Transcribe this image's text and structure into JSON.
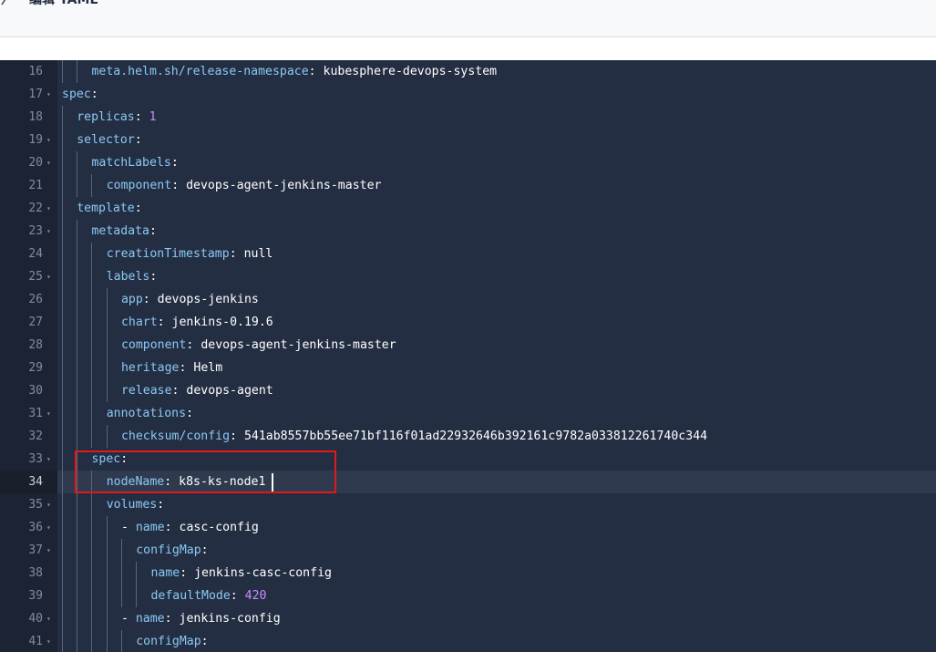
{
  "header": {
    "title": "编辑 YAML"
  },
  "editor": {
    "active_line": 34,
    "lines": [
      {
        "num": "16",
        "fold": false,
        "indent": 2,
        "key": "meta.helm.sh/release-namespace",
        "sep": ": ",
        "value": "kubesphere-devops-system",
        "vtype": "str"
      },
      {
        "num": "17",
        "fold": true,
        "indent": 0,
        "key": "spec",
        "sep": ":",
        "value": "",
        "vtype": "str"
      },
      {
        "num": "18",
        "fold": false,
        "indent": 1,
        "key": "replicas",
        "sep": ": ",
        "value": "1",
        "vtype": "num"
      },
      {
        "num": "19",
        "fold": true,
        "indent": 1,
        "key": "selector",
        "sep": ":",
        "value": "",
        "vtype": "str"
      },
      {
        "num": "20",
        "fold": true,
        "indent": 2,
        "key": "matchLabels",
        "sep": ":",
        "value": "",
        "vtype": "str"
      },
      {
        "num": "21",
        "fold": false,
        "indent": 3,
        "key": "component",
        "sep": ": ",
        "value": "devops-agent-jenkins-master",
        "vtype": "str"
      },
      {
        "num": "22",
        "fold": true,
        "indent": 1,
        "key": "template",
        "sep": ":",
        "value": "",
        "vtype": "str"
      },
      {
        "num": "23",
        "fold": true,
        "indent": 2,
        "key": "metadata",
        "sep": ":",
        "value": "",
        "vtype": "str"
      },
      {
        "num": "24",
        "fold": false,
        "indent": 3,
        "key": "creationTimestamp",
        "sep": ": ",
        "value": "null",
        "vtype": "str"
      },
      {
        "num": "25",
        "fold": true,
        "indent": 3,
        "key": "labels",
        "sep": ":",
        "value": "",
        "vtype": "str"
      },
      {
        "num": "26",
        "fold": false,
        "indent": 4,
        "key": "app",
        "sep": ": ",
        "value": "devops-jenkins",
        "vtype": "str"
      },
      {
        "num": "27",
        "fold": false,
        "indent": 4,
        "key": "chart",
        "sep": ": ",
        "value": "jenkins-0.19.6",
        "vtype": "str"
      },
      {
        "num": "28",
        "fold": false,
        "indent": 4,
        "key": "component",
        "sep": ": ",
        "value": "devops-agent-jenkins-master",
        "vtype": "str"
      },
      {
        "num": "29",
        "fold": false,
        "indent": 4,
        "key": "heritage",
        "sep": ": ",
        "value": "Helm",
        "vtype": "str"
      },
      {
        "num": "30",
        "fold": false,
        "indent": 4,
        "key": "release",
        "sep": ": ",
        "value": "devops-agent",
        "vtype": "str"
      },
      {
        "num": "31",
        "fold": true,
        "indent": 3,
        "key": "annotations",
        "sep": ":",
        "value": "",
        "vtype": "str"
      },
      {
        "num": "32",
        "fold": false,
        "indent": 4,
        "key": "checksum/config",
        "sep": ": ",
        "value": "541ab8557bb55ee71bf116f01ad22932646b392161c9782a033812261740c344",
        "vtype": "str"
      },
      {
        "num": "33",
        "fold": true,
        "indent": 2,
        "key": "spec",
        "sep": ":",
        "value": "",
        "vtype": "str"
      },
      {
        "num": "34",
        "fold": false,
        "indent": 3,
        "key": "nodeName",
        "sep": ": ",
        "value": "k8s-ks-node1",
        "vtype": "str"
      },
      {
        "num": "35",
        "fold": true,
        "indent": 3,
        "key": "volumes",
        "sep": ":",
        "value": "",
        "vtype": "str"
      },
      {
        "num": "36",
        "fold": true,
        "indent": 4,
        "dash": true,
        "key": "name",
        "sep": ": ",
        "value": "casc-config",
        "vtype": "str"
      },
      {
        "num": "37",
        "fold": true,
        "indent": 5,
        "key": "configMap",
        "sep": ":",
        "value": "",
        "vtype": "str"
      },
      {
        "num": "38",
        "fold": false,
        "indent": 6,
        "key": "name",
        "sep": ": ",
        "value": "jenkins-casc-config",
        "vtype": "str"
      },
      {
        "num": "39",
        "fold": false,
        "indent": 6,
        "key": "defaultMode",
        "sep": ": ",
        "value": "420",
        "vtype": "num"
      },
      {
        "num": "40",
        "fold": true,
        "indent": 4,
        "dash": true,
        "key": "name",
        "sep": ": ",
        "value": "jenkins-config",
        "vtype": "str"
      },
      {
        "num": "41",
        "fold": true,
        "indent": 5,
        "key": "configMap",
        "sep": ":",
        "value": "",
        "vtype": "str"
      }
    ]
  },
  "colors": {
    "editor_bg": "#242e42",
    "key": "#8ac9f5",
    "number": "#c58dff",
    "highlight_box": "#e0191a"
  }
}
